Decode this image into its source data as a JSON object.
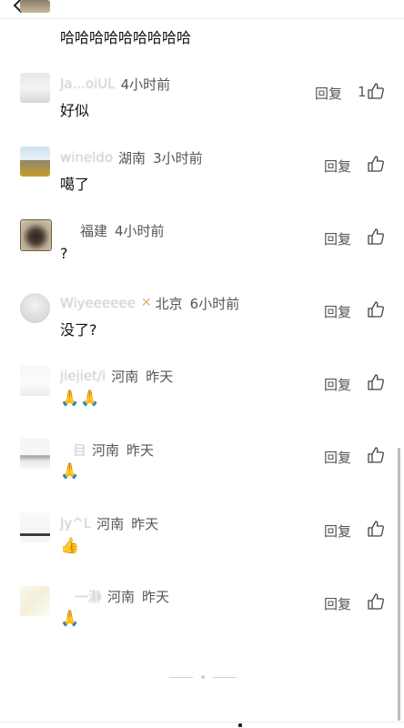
{
  "first_comment": {
    "text": "哈哈哈哈哈哈哈哈哈"
  },
  "comments": [
    {
      "username": "Ja...oiUL",
      "time": "4小时前",
      "text": "好似",
      "reply": "回复",
      "likes": "1"
    },
    {
      "username": "wineldo",
      "region": "湖南",
      "time": "3小时前",
      "text": "噶了",
      "reply": "回复"
    },
    {
      "region": "福建",
      "time": "4小时前",
      "text": "?",
      "reply": "回复"
    },
    {
      "username": "Wiyeeeeee",
      "region": "北京",
      "time": "6小时前",
      "text": "没了?",
      "reply": "回复"
    },
    {
      "username": "jiejiet/i",
      "region": "河南",
      "time": "昨天",
      "text": "🙏🙏",
      "reply": "回复"
    },
    {
      "username": "目",
      "region": "河南",
      "time": "昨天",
      "text": "🙏",
      "reply": "回复"
    },
    {
      "username": "Jy^L",
      "region": "河南",
      "time": "昨天",
      "text": "👍",
      "reply": "回复"
    },
    {
      "username": "一瀞",
      "region": "河南",
      "time": "昨天",
      "text": "🙏",
      "reply": "回复"
    }
  ]
}
